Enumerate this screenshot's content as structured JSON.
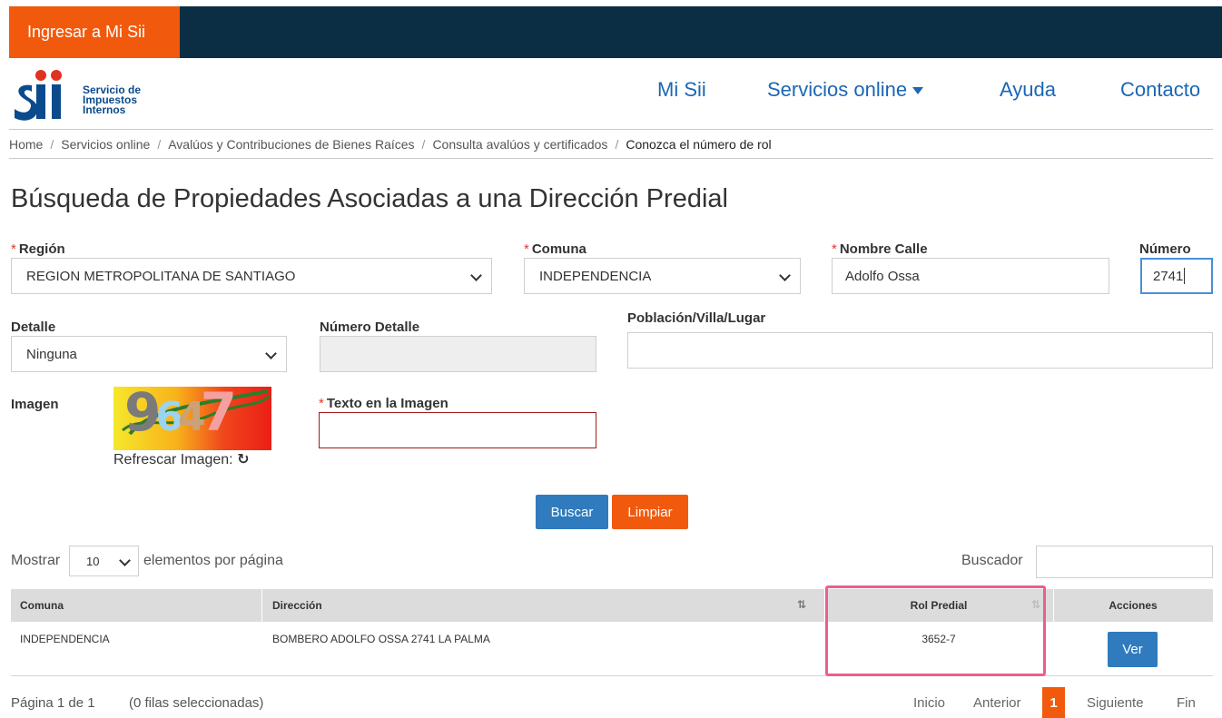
{
  "topbar": {
    "login_label": "Ingresar a Mi Sii"
  },
  "logo": {
    "letters": "Sii",
    "line1": "Servicio de",
    "line2": "Impuestos",
    "line3": "Internos"
  },
  "nav": {
    "mi_sii": "Mi Sii",
    "servicios": "Servicios online",
    "ayuda": "Ayuda",
    "contacto": "Contacto"
  },
  "breadcrumb": {
    "items": [
      "Home",
      "Servicios online",
      "Avalúos y Contribuciones de Bienes Raíces",
      "Consulta avalúos y certificados"
    ],
    "current": "Conozca el número de rol"
  },
  "page_title": "Búsqueda de Propiedades Asociadas a una Dirección Predial",
  "form": {
    "required_mark": "*",
    "region_label": "Región",
    "region_value": "REGION METROPOLITANA DE SANTIAGO",
    "comuna_label": "Comuna",
    "comuna_value": "INDEPENDENCIA",
    "calle_label": "Nombre Calle",
    "calle_value": "Adolfo Ossa",
    "numero_label": "Número",
    "numero_value": "2741",
    "detalle_label": "Detalle",
    "detalle_value": "Ninguna",
    "numero_detalle_label": "Número Detalle",
    "poblacion_label": "Población/Villa/Lugar",
    "imagen_label": "Imagen",
    "captcha_text": "9647",
    "refresh_label": "Refrescar Imagen:",
    "texto_imagen_label": "Texto en la Imagen",
    "buscar_label": "Buscar",
    "limpiar_label": "Limpiar"
  },
  "table_controls": {
    "mostrar": "Mostrar",
    "page_size": "10",
    "per_page": "elementos por página",
    "buscador": "Buscador"
  },
  "table": {
    "columns": [
      "Comuna",
      "Dirección",
      "Rol Predial",
      "Acciones"
    ],
    "rows": [
      {
        "comuna": "INDEPENDENCIA",
        "direccion": "BOMBERO ADOLFO OSSA 2741 LA PALMA",
        "rol": "3652-7",
        "action": "Ver"
      }
    ]
  },
  "footer": {
    "page_info": "Página 1 de 1",
    "selected_info": "(0 filas seleccionadas)",
    "inicio": "Inicio",
    "anterior": "Anterior",
    "current_page": "1",
    "siguiente": "Siguiente",
    "fin": "Fin"
  },
  "colors": {
    "topbar": "#0b2e45",
    "brand_orange": "#f15a0d",
    "link_blue": "#1a67b5",
    "button_blue": "#2f7bbd",
    "highlight_pink": "#ea5e93"
  }
}
